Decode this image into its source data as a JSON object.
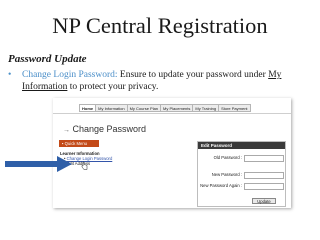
{
  "slide": {
    "title": "NP Central Registration",
    "subtitle": "Password Update",
    "bullet_highlight": "Change Login Password:",
    "bullet_text": " Ensure to update your password under ",
    "bullet_link": "My Information",
    "bullet_line2_link": "Information",
    "bullet_line2_text": "  to protect your privacy."
  },
  "screenshot": {
    "tabs": [
      "Home",
      "My Information",
      "My Course Plan",
      "My Placements",
      "My Training",
      "Store Payment"
    ],
    "active_tab": "Home",
    "page_heading": "Change Password",
    "menu_label": "Quick Menu",
    "left_menu_header": "Learner Information",
    "left_menu_items": [
      "Change Login Password",
      "Edit Address"
    ],
    "panel_title": "Edit Password",
    "field_labels": [
      "Old Password :",
      "New Password :",
      "New Password Again :"
    ],
    "update_button": "Update"
  },
  "colors": {
    "accent_blue": "#4a8ec8",
    "menu_orange": "#c34a18",
    "panel_header": "#3a3a3a",
    "arrow_blue": "#2f5fa8"
  }
}
